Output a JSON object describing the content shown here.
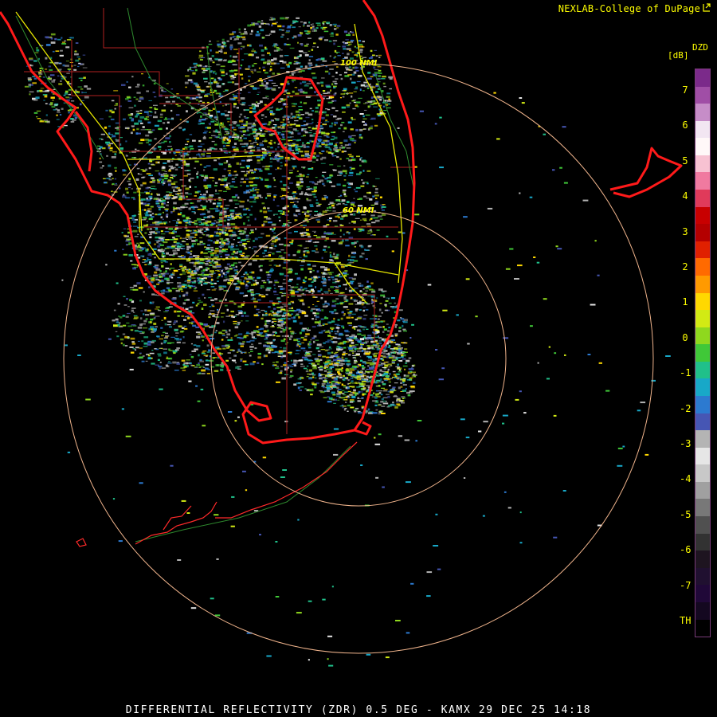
{
  "header": {
    "credit": "NEXLAB-College of DuPage",
    "credit_icon": "external-link-icon"
  },
  "footer": {
    "caption": "DIFFERENTIAL REFLECTIVITY (ZDR) 0.5 DEG - KAMX 29 DEC 25 14:18"
  },
  "map": {
    "range_rings": [
      {
        "label": "60 NMI"
      },
      {
        "label": "100 NMI"
      }
    ],
    "radar_site": "KAMX",
    "colors": {
      "coastline": "#ff1a1a",
      "county_lines": "#cc2222",
      "highways": "#ffff00",
      "range_rings": "#f0b48c"
    }
  },
  "legend": {
    "product": "DZD",
    "unit": "[dB]",
    "ticks": [
      "7",
      "6",
      "5",
      "4",
      "3",
      "2",
      "1",
      "0",
      "-1",
      "-2",
      "-3",
      "-4",
      "-5",
      "-6",
      "-7",
      "TH"
    ],
    "gradient": [
      "#7b2a8a",
      "#a04ea6",
      "#c68dc8",
      "#f2e6f2",
      "#fff8f8",
      "#f7c2d2",
      "#f07aa0",
      "#e03a5a",
      "#c80000",
      "#b40000",
      "#e02000",
      "#ff6a00",
      "#ff9a00",
      "#ffd800",
      "#d2ea14",
      "#8fd81e",
      "#40c838",
      "#20c08a",
      "#18a8c8",
      "#2c7ad0",
      "#4656b4",
      "#b4b4b4",
      "#e6e6e6",
      "#c8c8c8",
      "#a0a0a0",
      "#787878",
      "#505050",
      "#323232",
      "#1e1420",
      "#201030",
      "#200838",
      "#140820",
      "#000000"
    ]
  }
}
